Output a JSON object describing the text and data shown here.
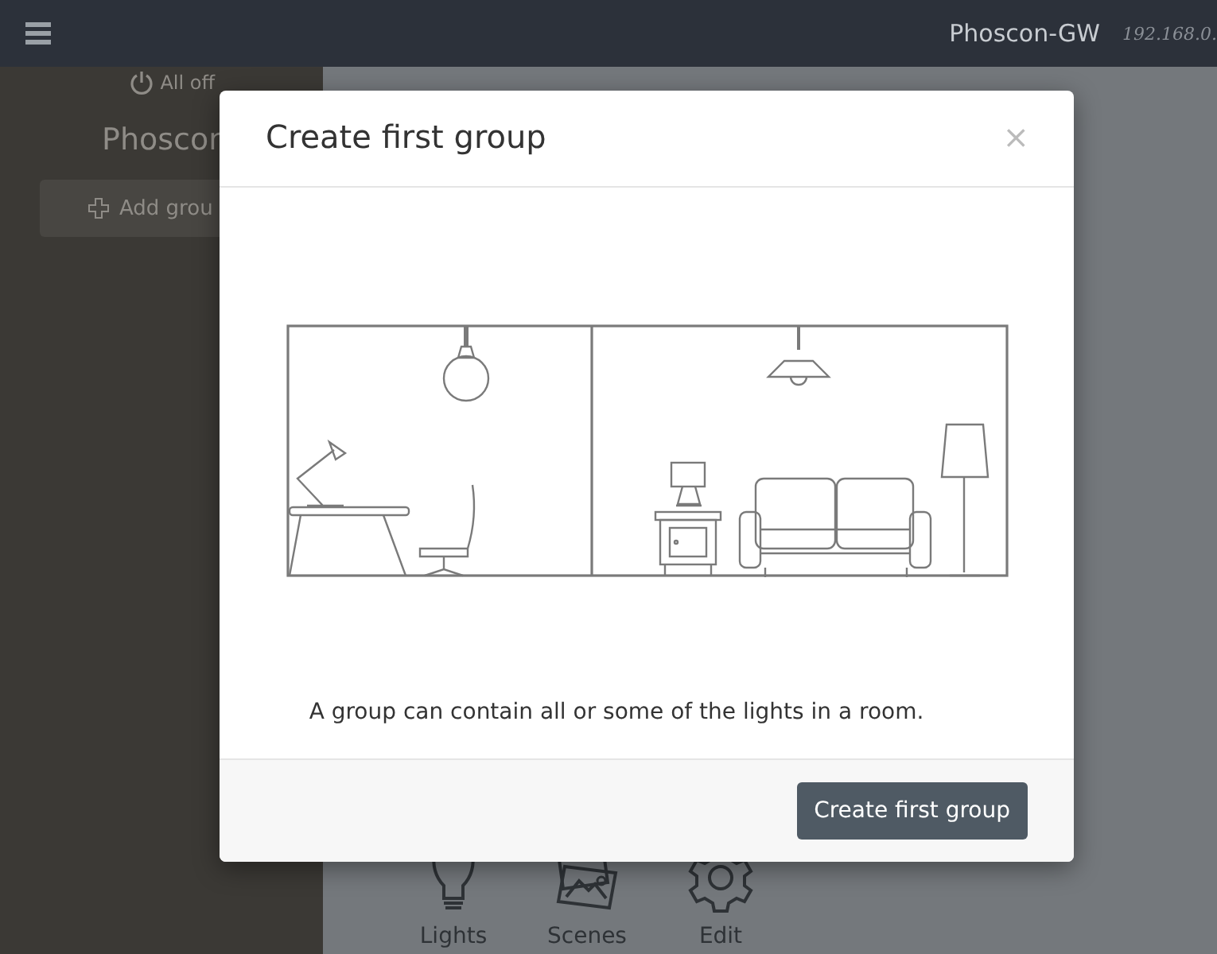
{
  "top_bar": {
    "title": "Phoscon-GW",
    "address": "192.168.0."
  },
  "sidebar": {
    "all_off": "All off",
    "gateway_name": "Phoscon",
    "add_group_button": "Add grou"
  },
  "bottom_nav": [
    {
      "kind": "bulb",
      "label": "Lights"
    },
    {
      "kind": "pictures",
      "label": "Scenes"
    },
    {
      "kind": "gear",
      "label": "Edit"
    }
  ],
  "dialog": {
    "title": "Create first group",
    "close": "×",
    "message": "A group can contain all or some of the lights in a room.",
    "button": "Create first group"
  }
}
